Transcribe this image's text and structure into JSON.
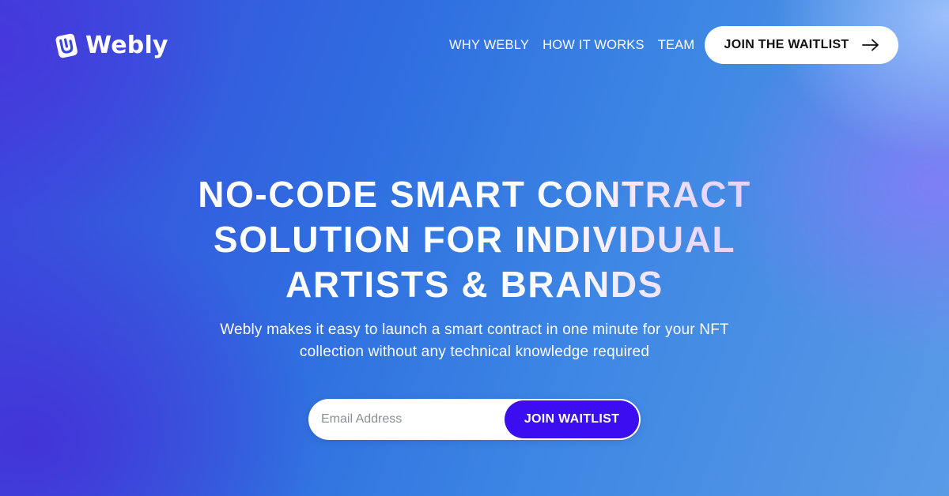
{
  "brand": {
    "name": "Webly",
    "logo_icon": "hand-card-logo-icon"
  },
  "nav": {
    "items": [
      {
        "label": "WHY WEBLY"
      },
      {
        "label": "HOW IT WORKS"
      },
      {
        "label": "TEAM"
      }
    ],
    "cta_label": "JOIN THE WAITLIST",
    "cta_icon": "arrow-right-icon"
  },
  "hero": {
    "title_lines": [
      "NO-CODE SMART CONTRACT",
      "SOLUTION FOR INDIVIDUAL",
      "ARTISTS & BRANDS"
    ],
    "subtitle_lines": [
      "Webly makes it easy to launch a smart contract in one minute for your NFT",
      "collection without any technical knowledge required"
    ]
  },
  "signup": {
    "email_placeholder": "Email Address",
    "email_value": "",
    "submit_label": "JOIN WAITLIST"
  },
  "colors": {
    "button_primary": "#3a0ef0",
    "background_start": "#3a46dc",
    "background_end": "#5a9be6",
    "text": "#ffffff"
  }
}
